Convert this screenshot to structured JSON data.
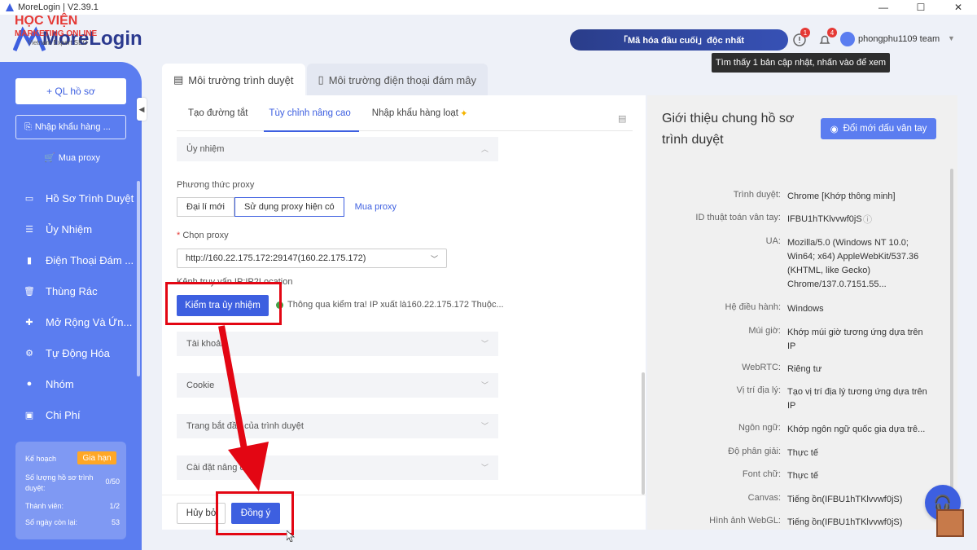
{
  "window": {
    "title": "MoreLogin | V2.39.1",
    "controls": [
      "—",
      "☐",
      "✕"
    ]
  },
  "watermark": {
    "line1": "HỌC VIỆN",
    "line2": "MARKETING ONLINE",
    "line3": "Vietnam Expert SEO"
  },
  "header": {
    "brand": "MoreLogin",
    "banner": "「Mã hóa đầu cuối」độc nhất",
    "update_badge": "1",
    "notif_badge": "4",
    "username": "phongphu1109 team",
    "tooltip": "Tìm thấy 1 bản cập nhật, nhấn vào để xem"
  },
  "sidebar": {
    "new_profile": "+ QL hồ sơ",
    "import": "Nhập khẩu hàng ...",
    "buy_proxy": "Mua proxy",
    "items": [
      {
        "label": "Hồ Sơ Trình Duyệt",
        "icon": "browser-icon"
      },
      {
        "label": "Ủy Nhiệm",
        "icon": "proxy-icon"
      },
      {
        "label": "Điện Thoại Đám ...",
        "icon": "phone-icon"
      },
      {
        "label": "Thùng Rác",
        "icon": "trash-icon"
      },
      {
        "label": "Mở Rộng Và Ứn...",
        "icon": "puzzle-icon"
      },
      {
        "label": "Tự Động Hóa",
        "icon": "automation-icon"
      },
      {
        "label": "Nhóm",
        "icon": "group-icon"
      },
      {
        "label": "Chi Phí",
        "icon": "wallet-icon"
      }
    ],
    "plan": {
      "label": "Kế hoạch",
      "renew": "Gia hạn",
      "profiles_label": "Số lượng hồ sơ trình duyệt:",
      "profiles_value": "0/50",
      "members_label": "Thành viên:",
      "members_value": "1/2",
      "days_label": "Số ngày còn lại:",
      "days_value": "53"
    }
  },
  "main_tabs": [
    {
      "label": "Môi trường trình duyệt",
      "active": true
    },
    {
      "label": "Môi trường điện thoại đám mây",
      "active": false
    }
  ],
  "form": {
    "sub_tabs": [
      {
        "label": "Tạo đường tắt",
        "active": false
      },
      {
        "label": "Tùy chỉnh nâng cao",
        "active": true
      },
      {
        "label": "Nhập khẩu hàng loạt",
        "active": false
      }
    ],
    "section_proxy": "Ủy nhiệm",
    "proxy_method_label": "Phương thức proxy",
    "proxy_methods": [
      "Đại lí mới",
      "Sử dụng proxy hiện có",
      "Mua proxy"
    ],
    "select_proxy_label": "Chọn proxy",
    "selected_proxy": "http://160.22.175.172:29147(160.22.175.172)",
    "lookup_label": "Kênh truy vấn IP:IP2Location",
    "check_button": "Kiểm tra ủy nhiệm",
    "check_result": "Thông qua kiểm tra! IP xuất là160.22.175.172 Thuộc...",
    "sections": [
      "Tài khoản",
      "Cookie",
      "Trang bắt đầu của trình duyệt",
      "Cài đặt nâng cao"
    ],
    "cancel": "Hủy bỏ",
    "ok": "Đồng ý"
  },
  "info": {
    "title": "Giới thiệu chung hồ sơ trình duyệt",
    "fingerprint_button": "Đổi mới dấu vân tay",
    "rows": [
      {
        "k": "Trình duyệt:",
        "v": "Chrome [Khớp thông minh]"
      },
      {
        "k": "ID thuật toán vân tay:",
        "v": "IFBU1hTKlvvwf0jS"
      },
      {
        "k": "UA:",
        "v": "Mozilla/5.0 (Windows NT 10.0; Win64; x64) AppleWebKit/537.36 (KHTML, like Gecko) Chrome/137.0.7151.55..."
      },
      {
        "k": "Hệ điều hành:",
        "v": "Windows"
      },
      {
        "k": "Múi giờ:",
        "v": "Khớp múi giờ tương ứng dựa trên IP"
      },
      {
        "k": "WebRTC:",
        "v": "Riêng tư"
      },
      {
        "k": "Vị trí địa lý:",
        "v": "Tạo vị trí địa lý tương ứng dựa trên IP"
      },
      {
        "k": "Ngôn ngữ:",
        "v": "Khớp ngôn ngữ quốc gia dựa trê..."
      },
      {
        "k": "Độ phân giải:",
        "v": "Thực tế"
      },
      {
        "k": "Font chữ:",
        "v": "Thực tế"
      },
      {
        "k": "Canvas:",
        "v": "Tiếng ồn(IFBU1hTKlvvwf0jS)"
      },
      {
        "k": "Hình ảnh WebGL:",
        "v": "Tiếng ồn(IFBU1hTKlvvwf0jS)"
      }
    ]
  },
  "colors": {
    "accent": "#3d5fe0",
    "sidebar": "#5b7df0",
    "annotation": "#e30613"
  }
}
